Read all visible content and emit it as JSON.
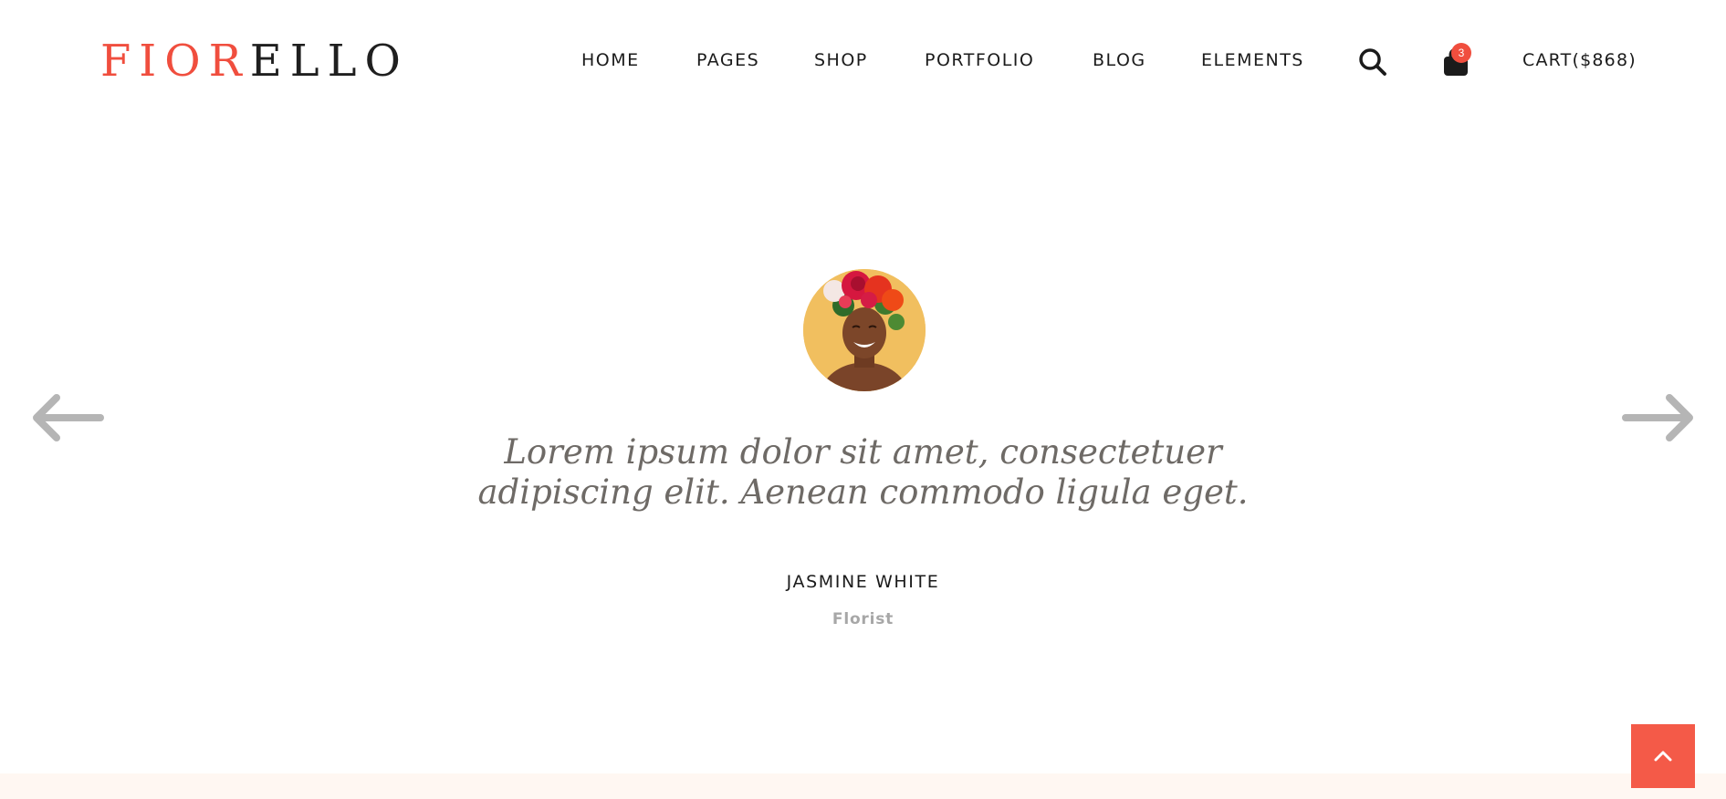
{
  "brand": {
    "logo_red": "FIOR",
    "logo_dark": "ELLO",
    "accent_color": "#f04e3e"
  },
  "nav": {
    "items": [
      {
        "label": "HOME"
      },
      {
        "label": "PAGES"
      },
      {
        "label": "SHOP"
      },
      {
        "label": "PORTFOLIO"
      },
      {
        "label": "BLOG"
      },
      {
        "label": "ELEMENTS"
      }
    ],
    "search_icon": "search-icon",
    "bag_icon": "shopping-bag-icon",
    "cart_count": "3",
    "cart_label": "CART($868)"
  },
  "testimonial": {
    "quote_line1": "Lorem ipsum dolor sit amet, consectetuer",
    "quote_line2": "adipiscing elit. Aenean commodo ligula eget.",
    "author": "JASMINE WHITE",
    "role": "Florist",
    "prev_icon": "arrow-left-icon",
    "next_icon": "arrow-right-icon"
  },
  "scroll_top": {
    "icon": "chevron-up-icon"
  }
}
